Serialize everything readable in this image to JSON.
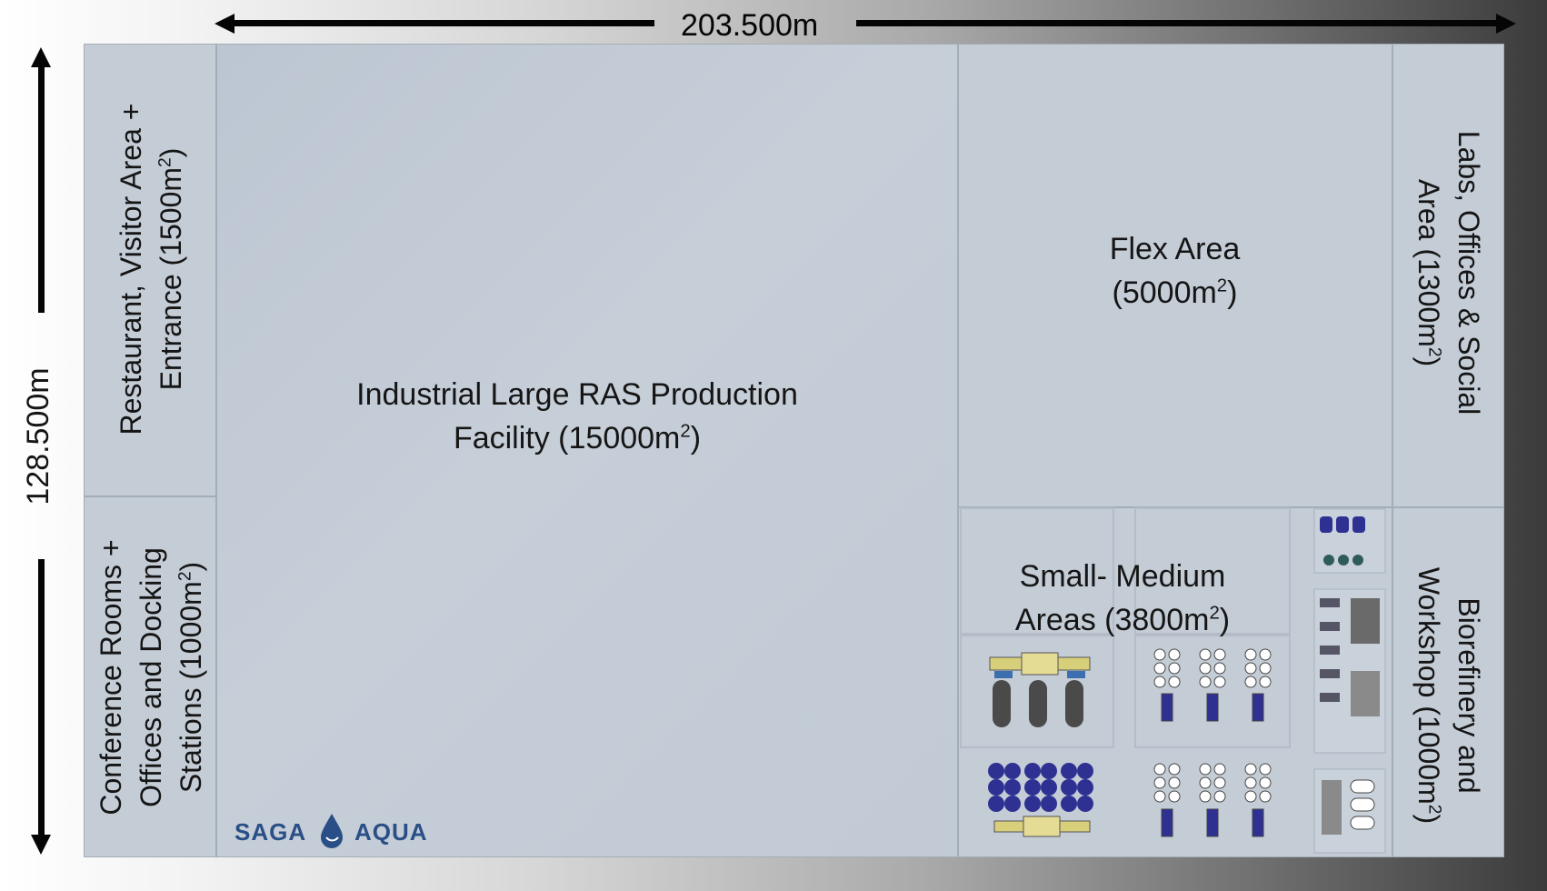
{
  "dimensions": {
    "width_label": "203.500m",
    "height_label": "128.500m"
  },
  "zones": {
    "restaurant": {
      "line1": "Restaurant, Visitor Area +",
      "line2": "Entrance (1500m",
      "sup": "2",
      "close": ")"
    },
    "conference": {
      "line1": "Conference Rooms +",
      "line2": "Offices and Docking",
      "line3": "Stations (1000m",
      "sup": "2",
      "close": ")"
    },
    "industrial": {
      "line1": "Industrial Large RAS Production",
      "line2": "Facility (15000m",
      "sup": "2",
      "close": ")"
    },
    "flex": {
      "line1": "Flex Area",
      "line2": "(5000m",
      "sup": "2",
      "close": ")"
    },
    "labs": {
      "line1": "Labs, Offices & Social",
      "line2": "Area (1300m",
      "sup": "2",
      "close": ")"
    },
    "small_medium": {
      "line1": "Small- Medium",
      "line2": "Areas (3800m",
      "sup": "2",
      "close": ")"
    },
    "biorefinery": {
      "line1": "Biorefinery and",
      "line2": "Workshop (1000m",
      "sup": "2",
      "close": ")"
    }
  },
  "logo": {
    "left": "SAGA",
    "right": "AQUA",
    "icon": "water-drop-icon"
  },
  "colors": {
    "zone_fill": "#c4ccd6",
    "equipment_blue": "#2e3192",
    "equipment_dark": "#4a4a4a",
    "logo_blue": "#2a4f86"
  }
}
